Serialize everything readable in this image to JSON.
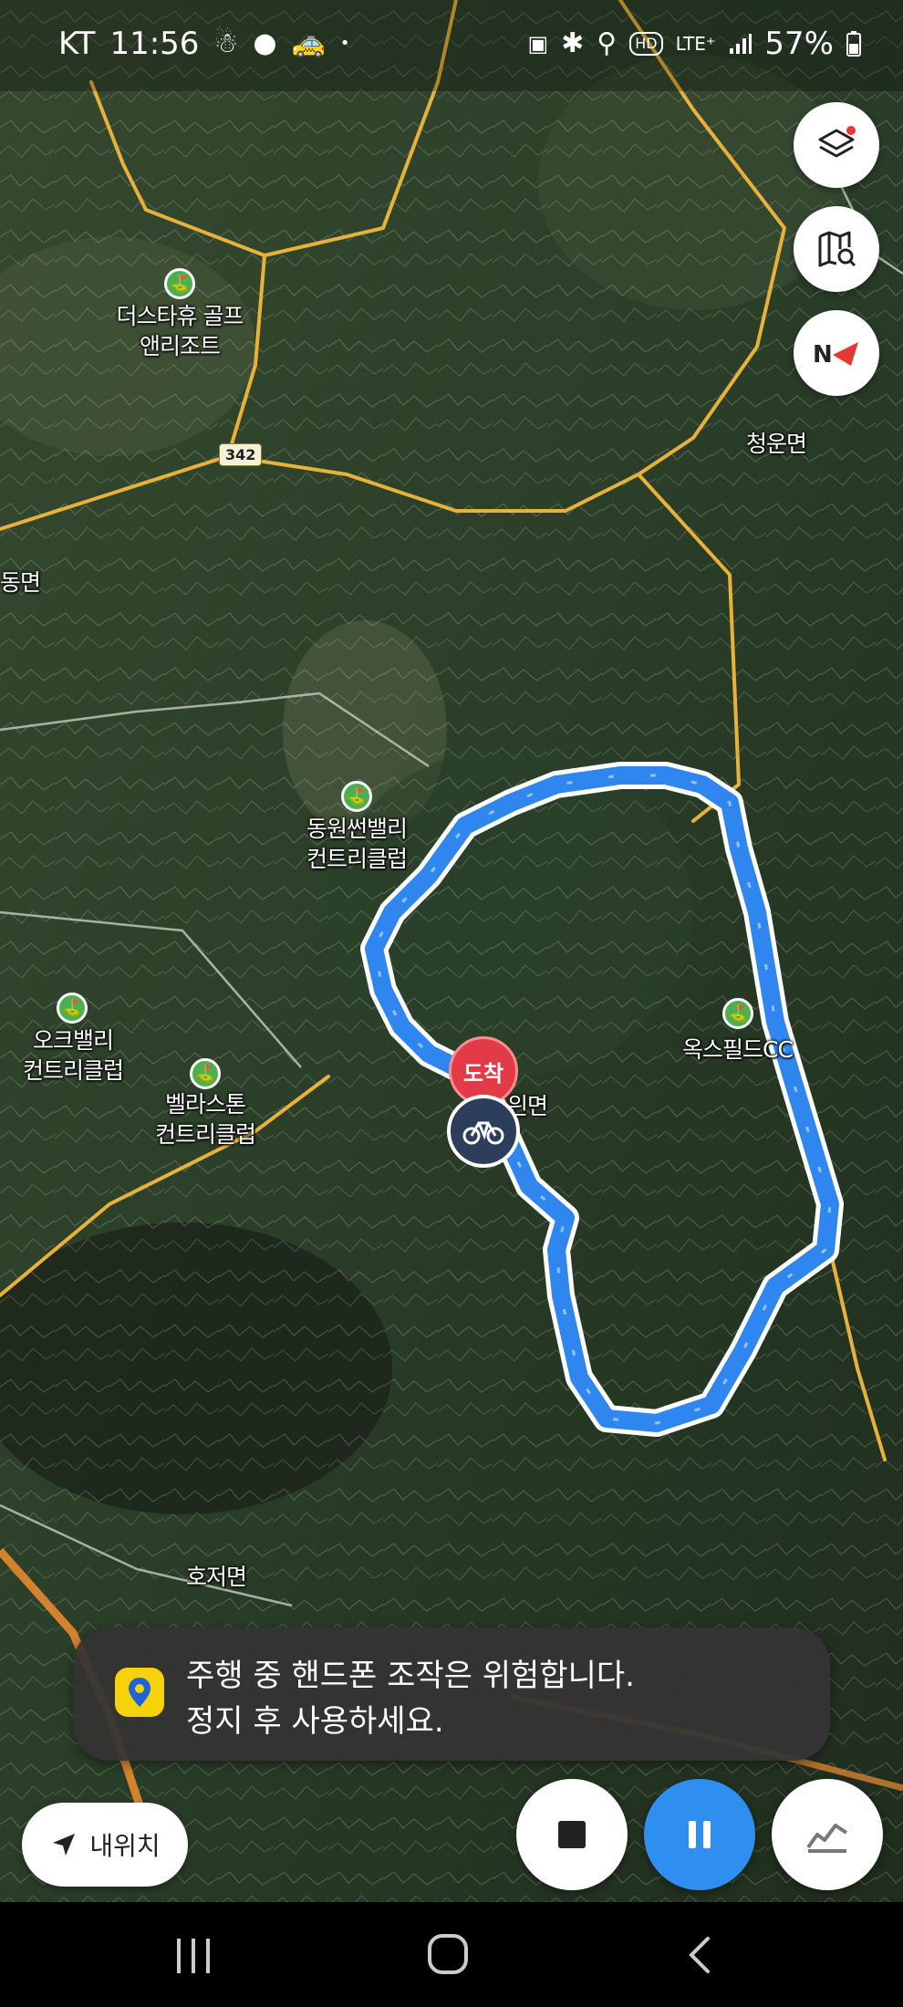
{
  "status_bar": {
    "carrier": "KT",
    "time": "11:56",
    "network": "LTE⁺",
    "battery": "57%",
    "icons_left": [
      "person-icon",
      "chat-bubble-icon",
      "car-icon",
      "dot-icon"
    ],
    "icons_right": [
      "nfc-icon",
      "bluetooth-icon",
      "location-icon",
      "hd-icon",
      "lte-icon",
      "signal-icon",
      "battery-icon"
    ]
  },
  "map": {
    "road_number": "342",
    "places": [
      {
        "name": "더스타휴 골프\n앤리조트",
        "golf": true
      },
      {
        "name": "청운면",
        "golf": false
      },
      {
        "name": "동면",
        "golf": false
      },
      {
        "name": "동원썬밸리\n컨트리클럽",
        "golf": true
      },
      {
        "name": "오크밸리\n컨트리클럽",
        "golf": true
      },
      {
        "name": "벨라스톤\n컨트리클럽",
        "golf": true
      },
      {
        "name": "옥스필드CC",
        "golf": true
      },
      {
        "name": "읜면",
        "golf": false
      },
      {
        "name": "호저면",
        "golf": false
      }
    ],
    "arrival_label": "도착",
    "route_color": "#2f86ee"
  },
  "map_tools": [
    {
      "name": "layers-icon"
    },
    {
      "name": "map-search-icon"
    },
    {
      "name": "compass-icon"
    }
  ],
  "toast": {
    "line1": "주행 중 핸드폰 조작은 위험합니다.",
    "line2": "정지 후 사용하세요."
  },
  "my_location": {
    "label": "내위치"
  },
  "controls": {
    "stop": "stop-icon",
    "pause": "pause-icon",
    "elevation": "elevation-chart-icon",
    "pause_color": "#2f8ff0"
  },
  "nav_bar": [
    "recents-icon",
    "home-icon",
    "back-icon"
  ]
}
